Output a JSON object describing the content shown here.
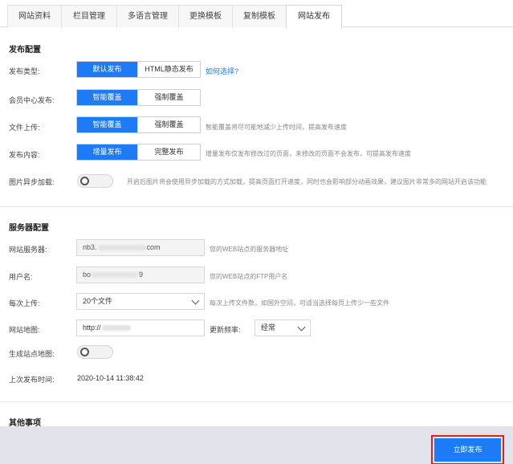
{
  "tabs": [
    "网站资料",
    "栏目管理",
    "多语言管理",
    "更换模板",
    "复制模板",
    "网站发布"
  ],
  "sections": {
    "publish_config": "发布配置",
    "server_config": "服务器配置",
    "other": "其他事项"
  },
  "publish_type": {
    "label": "发布类型:",
    "options": [
      "默认发布",
      "HTML静态发布"
    ],
    "selected": "默认发布",
    "help_link": "如何选择?"
  },
  "member_center": {
    "label": "会员中心发布:",
    "options": [
      "智能覆盖",
      "强制覆盖"
    ],
    "selected": "智能覆盖"
  },
  "file_upload": {
    "label": "文件上传:",
    "options": [
      "智能覆盖",
      "强制覆盖"
    ],
    "selected": "智能覆盖",
    "hint": "智能覆盖将尽可能地减少上传时间，提高发布速度"
  },
  "publish_content": {
    "label": "发布内容:",
    "options": [
      "增量发布",
      "完整发布"
    ],
    "selected": "增量发布",
    "hint": "增量发布仅发布修改过的页面，未修改的页面不会发布，可提高发布速度"
  },
  "async_images": {
    "label": "图片异步加载:",
    "enabled": false,
    "hint": "开启后图片将会使用异步加载的方式加载，提高页面打开速度，同时也会影响部分动画效果，建议图片非常多的网站开启该功能"
  },
  "server": {
    "label": "网站服务器:",
    "value_start": "nb3.",
    "value_end": "com",
    "hint": "您的WEB站点的服务器地址"
  },
  "username": {
    "label": "用户名:",
    "value_start": "bo",
    "value_end": "9",
    "hint": "您的WEB站点的FTP用户名"
  },
  "per_upload": {
    "label": "每次上传:",
    "value": "20个文件",
    "hint": "每次上传文件数，如国外空间，可适当选择每页上传少一些文件"
  },
  "sitemap": {
    "label": "网站地图:",
    "value_start": "http://",
    "freq_label": "更新频率:",
    "freq_value": "经常"
  },
  "generate_sitemap": {
    "label": "生成站点地图:",
    "enabled": false
  },
  "last_publish": {
    "label": "上次发布时间:",
    "value": "2020-10-14 11:38:42"
  },
  "footer": {
    "publish_button": "立即发布"
  },
  "colors": {
    "accent": "#1f7bf5",
    "highlight": "#e02020"
  }
}
